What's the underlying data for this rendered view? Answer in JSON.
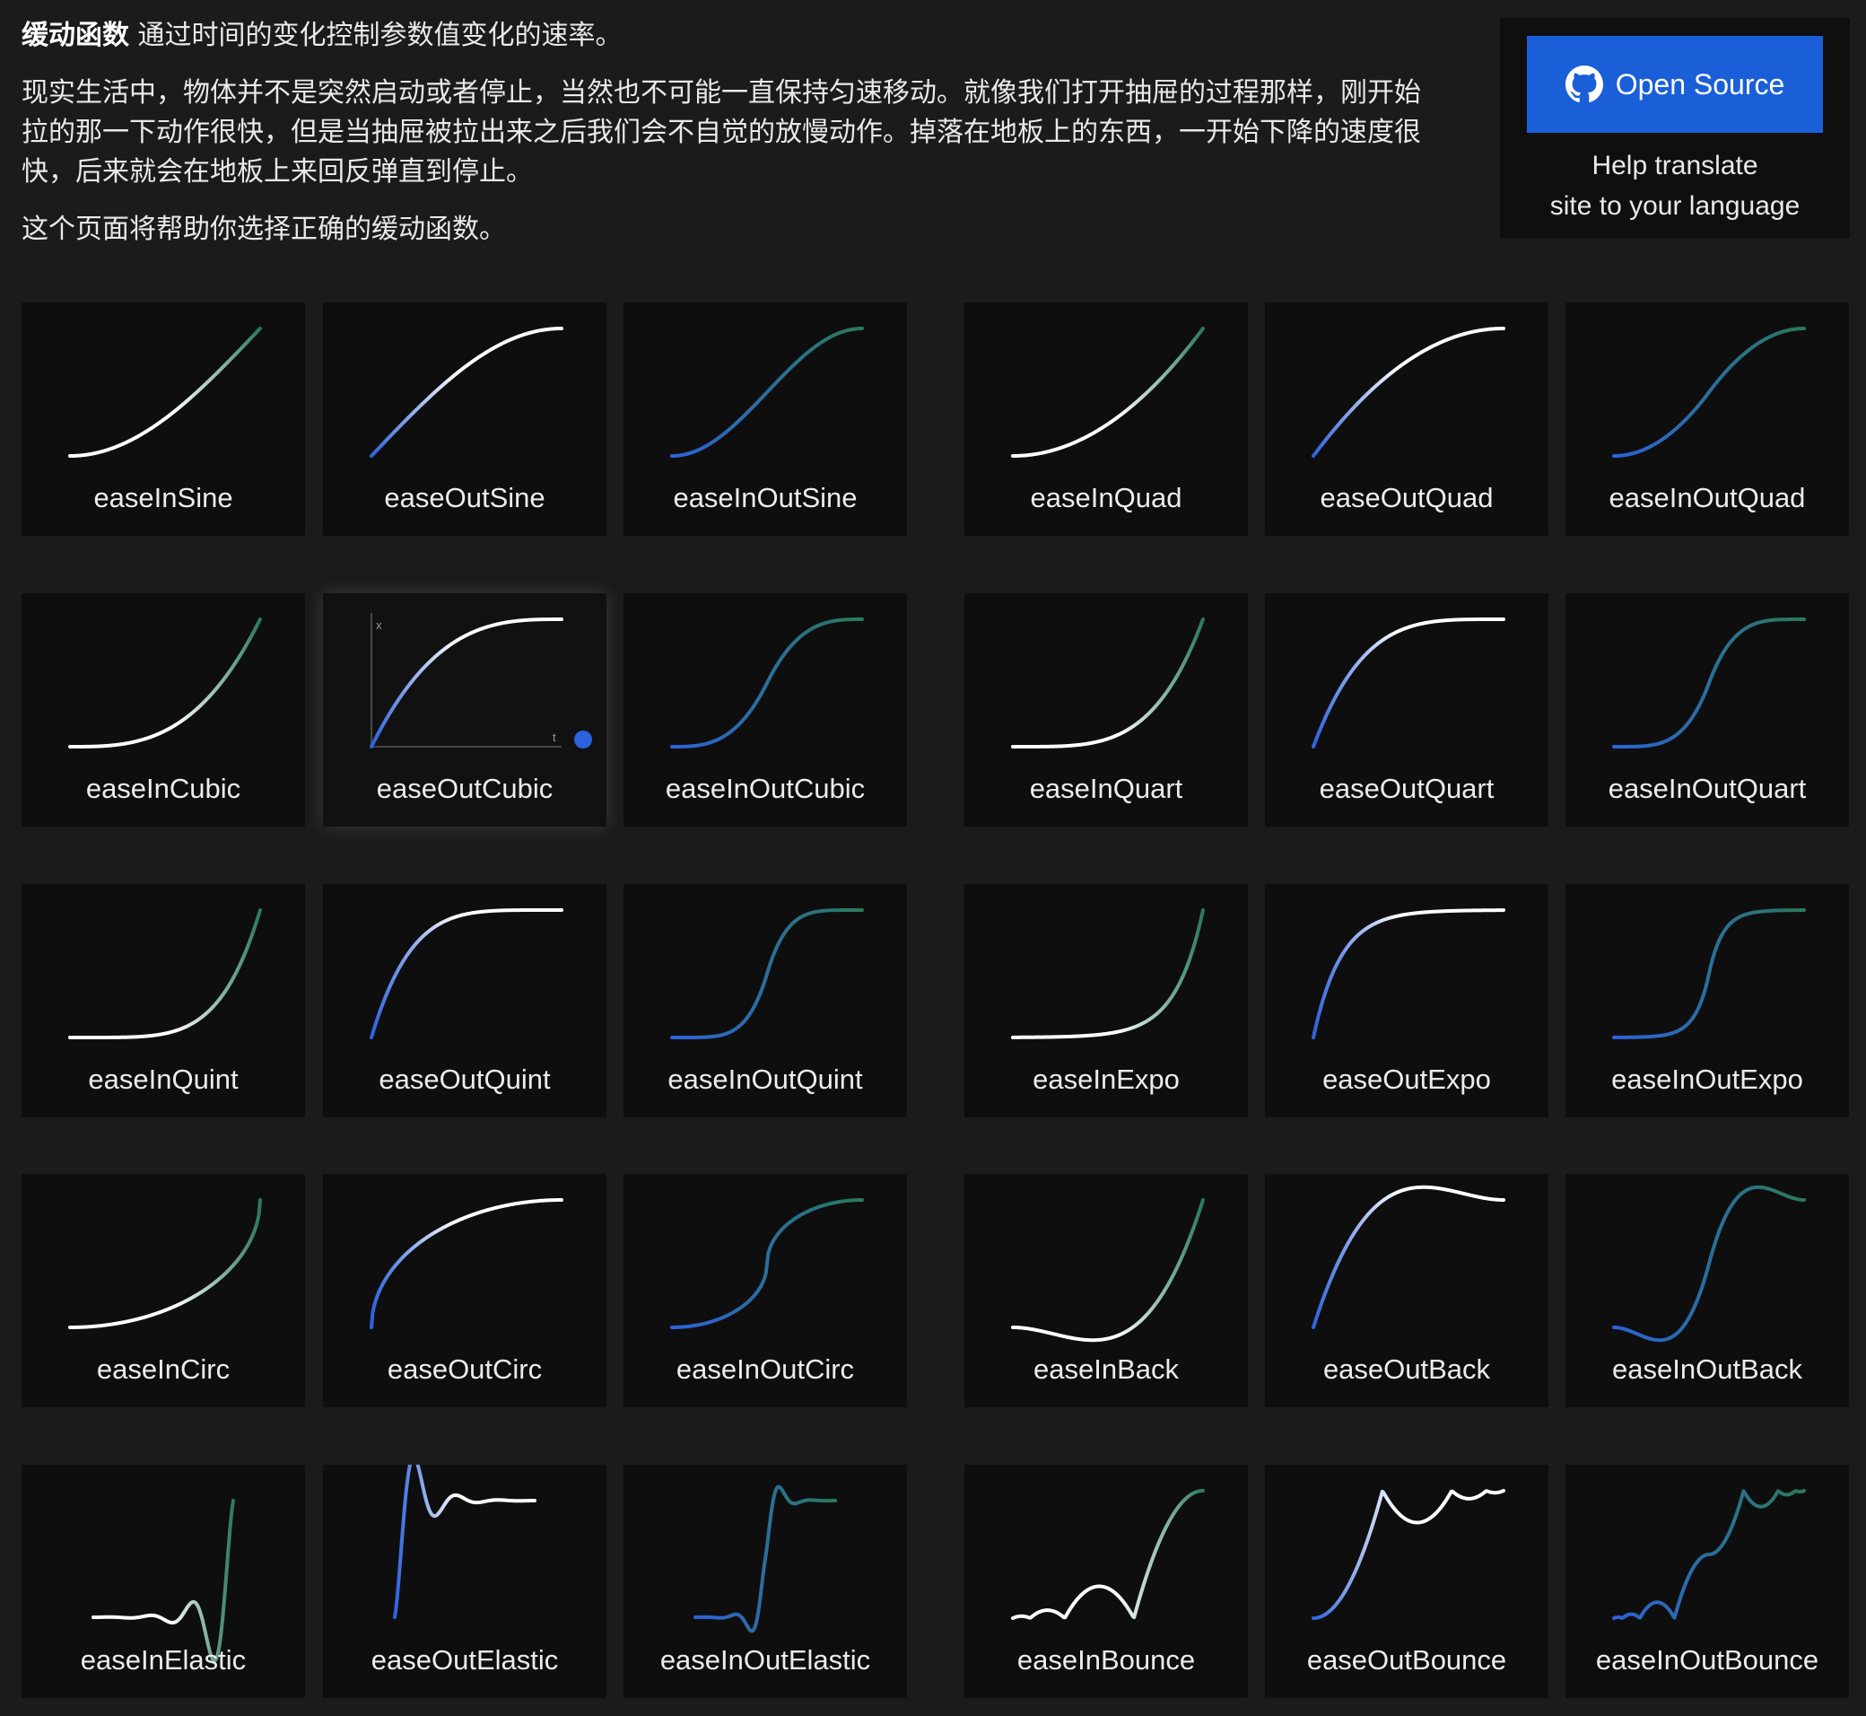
{
  "intro": {
    "bold": "缓动函数",
    "line1": "通过时间的变化控制参数值变化的速率。",
    "para2": "现实生活中，物体并不是突然启动或者停止，当然也不可能一直保持匀速移动。就像我们打开抽屉的过程那样，刚开始拉的那一下动作很快，但是当抽屉被拉出来之后我们会不自觉的放慢动作。掉落在地板上的东西，一开始下降的速度很快，后来就会在地板上来回反弹直到停止。",
    "para3": "这个页面将帮助你选择正确的缓动函数。"
  },
  "open_source": {
    "button_label": "Open Source",
    "icon": "github-icon",
    "help_line1": "Help translate",
    "help_line2": "site to your language"
  },
  "colors": {
    "background": "#1b1b1c",
    "card": "#0e0e0f",
    "button": "#1a5fd8",
    "curve_blue": "#2d62dc",
    "curve_white": "#ffffff",
    "curve_green": "#2a7a5a"
  },
  "active_card": {
    "name": "easeOutCubic",
    "axis_x_label": "x",
    "axis_t_label": "t"
  },
  "easings": [
    "easeInSine",
    "easeOutSine",
    "easeInOutSine",
    "easeInQuad",
    "easeOutQuad",
    "easeInOutQuad",
    "easeInCubic",
    "easeOutCubic",
    "easeInOutCubic",
    "easeInQuart",
    "easeOutQuart",
    "easeInOutQuart",
    "easeInQuint",
    "easeOutQuint",
    "easeInOutQuint",
    "easeInExpo",
    "easeOutExpo",
    "easeInOutExpo",
    "easeInCirc",
    "easeOutCirc",
    "easeInOutCirc",
    "easeInBack",
    "easeOutBack",
    "easeInOutBack",
    "easeInElastic",
    "easeOutElastic",
    "easeInOutElastic",
    "easeInBounce",
    "easeOutBounce",
    "easeInOutBounce"
  ]
}
